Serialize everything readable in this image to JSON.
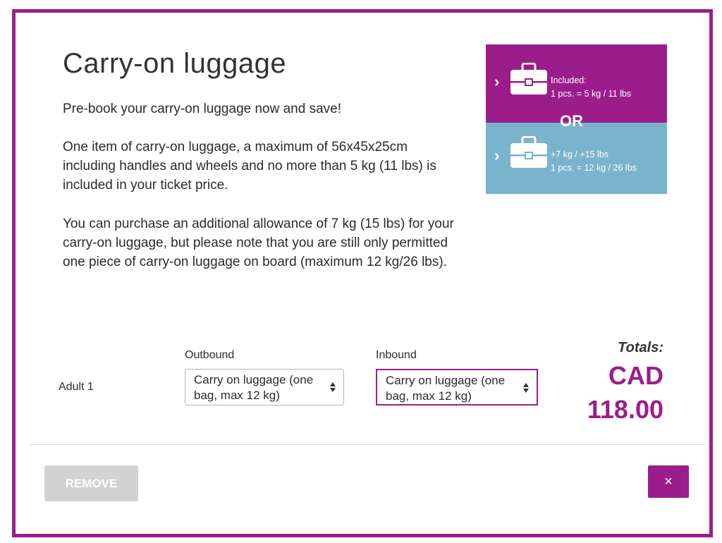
{
  "title": "Carry-on luggage",
  "intro": "Pre-book your carry-on luggage now and save!",
  "paragraph2": "One item of carry-on luggage, a maximum of 56x45x25cm including handles and wheels and no more than 5 kg (11 lbs) is included in your ticket price.",
  "paragraph3": "You can purchase an additional allowance of 7 kg (15 lbs) for your carry-on luggage, but please note that you are still only permitted one piece of carry-on luggage on board (maximum 12 kg/26 lbs).",
  "promo": {
    "option1_line1": "Included:",
    "option1_line2": "1 pcs. = 5 kg / 11 lbs",
    "or_text": "OR",
    "option2_line1": "+7 kg  / +15 lbs",
    "option2_line2": "1 pcs. = 12 kg / 26 lbs",
    "top_color": "#9b1d8c",
    "bottom_color": "#79b4cc",
    "icons": [
      "chevron-right-icon",
      "suitcase-icon"
    ]
  },
  "passenger": "Adult 1",
  "outbound": {
    "label": "Outbound",
    "value": "Carry on luggage (one bag, max 12 kg)"
  },
  "inbound": {
    "label": "Inbound",
    "value": "Carry on luggage (one bag, max 12 kg)"
  },
  "totals": {
    "label": "Totals:",
    "currency": "CAD",
    "amount": "118.00"
  },
  "buttons": {
    "remove": "REMOVE",
    "close": "×"
  },
  "accent_color": "#9b1d8c"
}
